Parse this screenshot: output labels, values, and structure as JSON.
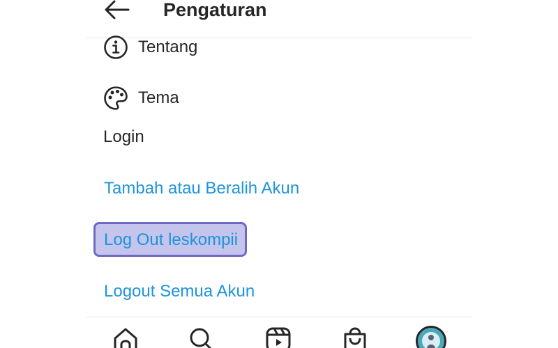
{
  "header": {
    "title": "Pengaturan",
    "back_icon": "arrow-left-icon"
  },
  "menu": {
    "items": [
      {
        "label": "Tentang",
        "icon": "info-circle-icon"
      },
      {
        "label": "Tema",
        "icon": "palette-icon"
      }
    ]
  },
  "login_section": {
    "heading": "Login",
    "links": [
      {
        "label": "Tambah atau Beralih Akun"
      },
      {
        "label": "Log Out leskompii",
        "highlighted": true
      },
      {
        "label": "Logout Semua Akun"
      }
    ]
  },
  "bottom_nav": {
    "items": [
      {
        "icon": "home-icon"
      },
      {
        "icon": "search-icon"
      },
      {
        "icon": "reels-icon"
      },
      {
        "icon": "shop-bag-icon"
      },
      {
        "icon": "profile-avatar"
      }
    ]
  },
  "colors": {
    "link": "#1d94dc",
    "text": "#262626",
    "highlight_fill": "#c4c4ec",
    "highlight_border": "#7168c6",
    "divider": "#e6e6e6"
  }
}
